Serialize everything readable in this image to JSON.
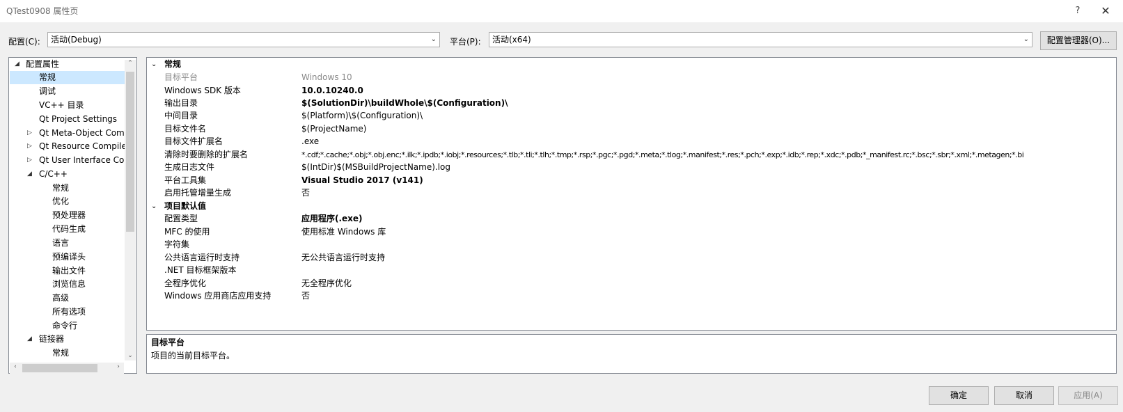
{
  "window": {
    "title": "QTest0908 属性页",
    "help": "?",
    "close": "✕"
  },
  "config_row": {
    "config_label": "配置(C):",
    "config_value": "活动(Debug)",
    "platform_label": "平台(P):",
    "platform_value": "活动(x64)",
    "manager_button": "配置管理器(O)..."
  },
  "tree": {
    "items": [
      {
        "label": "配置属性",
        "expander": "◢"
      },
      {
        "label": "常规"
      },
      {
        "label": "调试"
      },
      {
        "label": "VC++ 目录"
      },
      {
        "label": "Qt Project Settings"
      },
      {
        "label": "Qt Meta-Object Com",
        "expander": "▷"
      },
      {
        "label": "Qt Resource Compile",
        "expander": "▷"
      },
      {
        "label": "Qt User Interface Con",
        "expander": "▷"
      },
      {
        "label": "C/C++",
        "expander": "◢"
      },
      {
        "label": "常规"
      },
      {
        "label": "优化"
      },
      {
        "label": "预处理器"
      },
      {
        "label": "代码生成"
      },
      {
        "label": "语言"
      },
      {
        "label": "预编译头"
      },
      {
        "label": "输出文件"
      },
      {
        "label": "浏览信息"
      },
      {
        "label": "高级"
      },
      {
        "label": "所有选项"
      },
      {
        "label": "命令行"
      },
      {
        "label": "链接器",
        "expander": "◢"
      },
      {
        "label": "常规"
      }
    ]
  },
  "grid": {
    "cat1": "常规",
    "cat2": "项目默认值",
    "general": [
      {
        "name": "目标平台",
        "value": "Windows 10"
      },
      {
        "name": "Windows SDK 版本",
        "value": "10.0.10240.0"
      },
      {
        "name": "输出目录",
        "value": "$(SolutionDir)\\buildWhole\\$(Configuration)\\"
      },
      {
        "name": "中间目录",
        "value": "$(Platform)\\$(Configuration)\\"
      },
      {
        "name": "目标文件名",
        "value": "$(ProjectName)"
      },
      {
        "name": "目标文件扩展名",
        "value": ".exe"
      },
      {
        "name": "清除时要删除的扩展名",
        "value": "*.cdf;*.cache;*.obj;*.obj.enc;*.ilk;*.ipdb;*.iobj;*.resources;*.tlb;*.tli;*.tlh;*.tmp;*.rsp;*.pgc;*.pgd;*.meta;*.tlog;*.manifest;*.res;*.pch;*.exp;*.idb;*.rep;*.xdc;*.pdb;*_manifest.rc;*.bsc;*.sbr;*.xml;*.metagen;*.bi"
      },
      {
        "name": "生成日志文件",
        "value": "$(IntDir)$(MSBuildProjectName).log"
      },
      {
        "name": "平台工具集",
        "value": "Visual Studio 2017 (v141)"
      },
      {
        "name": "启用托管增量生成",
        "value": "否"
      }
    ],
    "defaults": [
      {
        "name": "配置类型",
        "value": "应用程序(.exe)"
      },
      {
        "name": "MFC 的使用",
        "value": "使用标准 Windows 库"
      },
      {
        "name": "字符集",
        "value": ""
      },
      {
        "name": "公共语言运行时支持",
        "value": "无公共语言运行时支持"
      },
      {
        "name": ".NET 目标框架版本",
        "value": ""
      },
      {
        "name": "全程序优化",
        "value": "无全程序优化"
      },
      {
        "name": "Windows 应用商店应用支持",
        "value": "否"
      }
    ]
  },
  "description": {
    "title": "目标平台",
    "text": "项目的当前目标平台。"
  },
  "buttons": {
    "ok": "确定",
    "cancel": "取消",
    "apply": "应用(A)"
  }
}
